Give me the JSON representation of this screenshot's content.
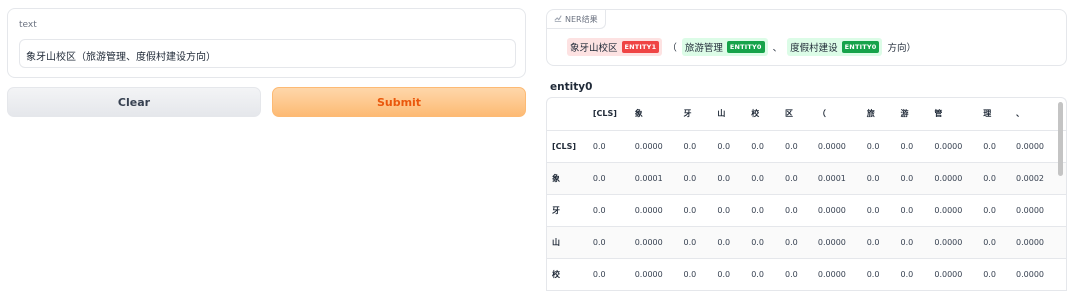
{
  "input": {
    "label": "text",
    "value": "象牙山校区（旅游管理、度假村建设方向）"
  },
  "buttons": {
    "clear": "Clear",
    "submit": "Submit"
  },
  "ner": {
    "tag_label": "NER结果",
    "segments": [
      {
        "text": "象牙山校区",
        "entity": "ENTITY1"
      },
      {
        "text": "（",
        "entity": null
      },
      {
        "text": "旅游管理",
        "entity": "ENTITY0"
      },
      {
        "text": "、",
        "entity": null
      },
      {
        "text": "度假村建设",
        "entity": "ENTITY0"
      },
      {
        "text": "方向）",
        "entity": null
      }
    ]
  },
  "entity_table": {
    "title": "entity0",
    "columns": [
      "",
      "[CLS]",
      "象",
      "牙",
      "山",
      "校",
      "区",
      "（",
      "旅",
      "游",
      "管",
      "理",
      "、"
    ],
    "rows": [
      [
        "[CLS]",
        "0.0",
        "0.0000",
        "0.0",
        "0.0",
        "0.0",
        "0.0",
        "0.0000",
        "0.0",
        "0.0",
        "0.0000",
        "0.0",
        "0.0000"
      ],
      [
        "象",
        "0.0",
        "0.0001",
        "0.0",
        "0.0",
        "0.0",
        "0.0",
        "0.0001",
        "0.0",
        "0.0",
        "0.0000",
        "0.0",
        "0.0002"
      ],
      [
        "牙",
        "0.0",
        "0.0000",
        "0.0",
        "0.0",
        "0.0",
        "0.0",
        "0.0000",
        "0.0",
        "0.0",
        "0.0000",
        "0.0",
        "0.0000"
      ],
      [
        "山",
        "0.0",
        "0.0000",
        "0.0",
        "0.0",
        "0.0",
        "0.0",
        "0.0000",
        "0.0",
        "0.0",
        "0.0000",
        "0.0",
        "0.0000"
      ],
      [
        "校",
        "0.0",
        "0.0000",
        "0.0",
        "0.0",
        "0.0",
        "0.0",
        "0.0000",
        "0.0",
        "0.0",
        "0.0000",
        "0.0",
        "0.0000"
      ]
    ]
  },
  "colors": {
    "entity1": "#ef4444",
    "entity1_bg": "#fde2e2",
    "entity0": "#16a34a",
    "entity0_bg": "#dcfce7",
    "submit_text": "#ea580c"
  }
}
